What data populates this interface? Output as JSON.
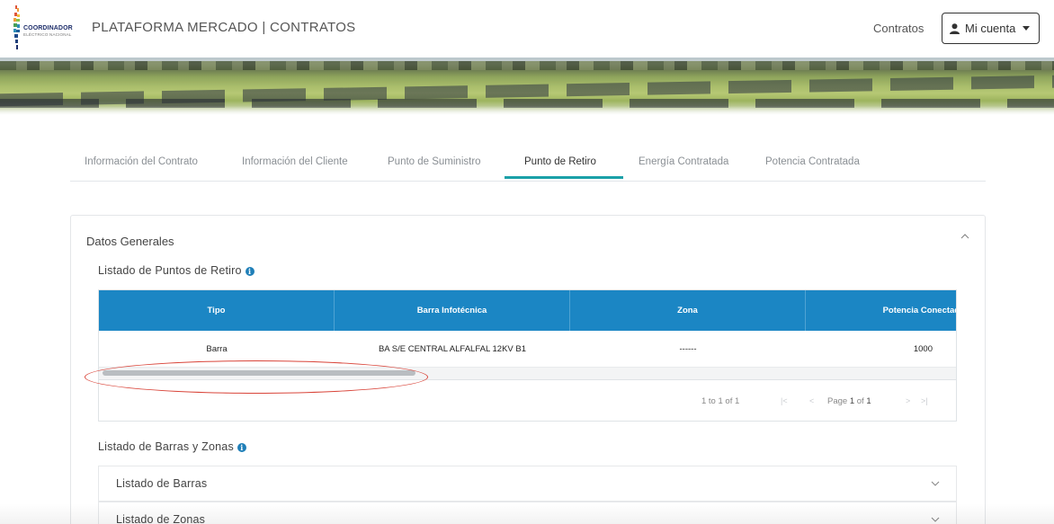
{
  "header": {
    "logo_text": "COORDINADOR",
    "logo_subtext": "ELÉCTRICO NACIONAL",
    "app_title": "PLATAFORMA MERCADO | CONTRATOS",
    "nav_contracts": "Contratos",
    "account_label": "Mi cuenta",
    "icons": {
      "account": "user-icon",
      "account_dropdown": "caret-down-icon"
    }
  },
  "tabs": [
    {
      "label": "Información del Contrato",
      "active": false
    },
    {
      "label": "Información del Cliente",
      "active": false
    },
    {
      "label": "Punto de Suministro",
      "active": false
    },
    {
      "label": "Punto de Retiro",
      "active": true
    },
    {
      "label": "Energía Contratada",
      "active": false
    },
    {
      "label": "Potencia Contratada",
      "active": false
    }
  ],
  "card": {
    "title": "Datos Generales",
    "collapse_icon": "chevron-up-icon",
    "puntos_section_title": "Listado de Puntos de Retiro",
    "info_icon_glyph": "i",
    "grid": {
      "columns": [
        "Tipo",
        "Barra Infotécnica",
        "Zona",
        "Potencia Conectada"
      ],
      "rows": [
        {
          "tipo": "Barra",
          "barra": "BA S/E CENTRAL ALFALFAL 12KV B1",
          "zona": "------",
          "potencia": "1000"
        }
      ],
      "pager": {
        "summary": "1 to 1 of 1",
        "first": "|<",
        "prev": "<",
        "page_word": "Page",
        "page": "1",
        "of_word": "of",
        "total": "1",
        "next": ">",
        "last": ">|"
      }
    },
    "barras_section_title": "Listado de Barras y Zonas",
    "accordions": [
      {
        "label": "Listado de Barras"
      },
      {
        "label": "Listado de Zonas"
      }
    ]
  },
  "colors": {
    "grid_header": "#1b86c4",
    "tab_active_underline": "#1ba0a8",
    "annotation_ellipse": "#d9453a",
    "info_icon": "#1f7fb8"
  }
}
